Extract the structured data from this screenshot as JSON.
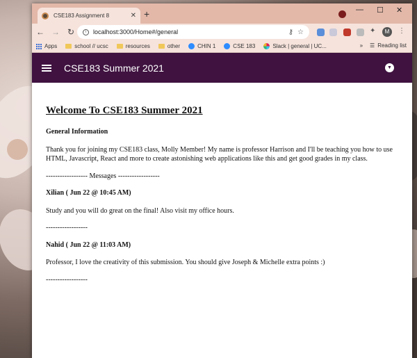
{
  "browser": {
    "tab_title": "CSE183 Assignment 8",
    "url": "localhost:3000/Home#/general",
    "avatar_letter": "M",
    "bookmarks": [
      {
        "label": "Apps",
        "icon": "apps-grid-icon"
      },
      {
        "label": "school // ucsc",
        "icon": "folder-icon"
      },
      {
        "label": "resources",
        "icon": "folder-icon"
      },
      {
        "label": "other",
        "icon": "folder-icon"
      },
      {
        "label": "CHIN 1",
        "icon": "zoom-icon"
      },
      {
        "label": "CSE 183",
        "icon": "zoom-icon"
      },
      {
        "label": "Slack | general | UC...",
        "icon": "slack-icon"
      }
    ],
    "reading_list": "Reading list"
  },
  "app": {
    "title": "CSE183 Summer 2021",
    "accent_color": "#3f1240"
  },
  "page": {
    "heading": "Welcome To CSE183 Summer 2021",
    "section_title": "General Information",
    "intro": "Thank you for joining my CSE183 class, Molly Member! My name is professor Harrison and I'll be teaching you how to use HTML, Javascript, React and more to create astonishing web applications like this and get good grades in my class.",
    "messages_divider": "------------------ Messages ------------------",
    "messages": [
      {
        "author": "Xilian ( Jun 22 @ 10:45 AM)",
        "text": "Study and you will do great on the final! Also visit my office hours.",
        "divider": "------------------"
      },
      {
        "author": "Nahid ( Jun 22 @ 11:03 AM)",
        "text": "Professor, I love the creativity of this submission. You should give Joseph & Michelle extra points :)",
        "divider": "------------------"
      }
    ]
  }
}
